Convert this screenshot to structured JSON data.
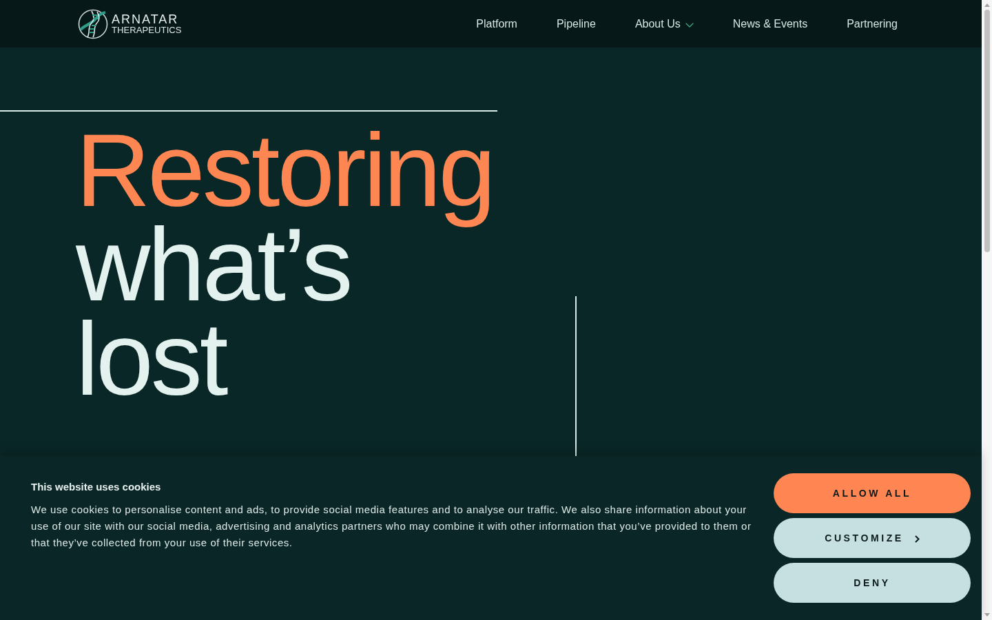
{
  "logo": {
    "name": "ARNATAR",
    "tagline": "THERAPEUTICS"
  },
  "nav": {
    "items": [
      {
        "label": "Platform",
        "dropdown": false
      },
      {
        "label": "Pipeline",
        "dropdown": false
      },
      {
        "label": "About Us",
        "dropdown": true
      },
      {
        "label": "News & Events",
        "dropdown": false
      },
      {
        "label": "Partnering",
        "dropdown": false
      }
    ]
  },
  "hero": {
    "headline": [
      {
        "text": "Restoring",
        "accent": true
      },
      {
        "text": "what’s",
        "accent": false
      },
      {
        "text": "lost",
        "accent": false
      }
    ]
  },
  "cookie_banner": {
    "title": "This website uses cookies",
    "text": "We use cookies to personalise content and ads, to provide social media features and to analyse our traffic. We also share information about your use of our site with our social media, advertising and analytics partners who may combine it with other information that you’ve provided to them or that they’ve collected from your use of their services.",
    "buttons": [
      {
        "label": "ALLOW ALL",
        "kind": "primary",
        "chevron": false
      },
      {
        "label": "CUSTOMIZE",
        "kind": "secondary",
        "chevron": true
      },
      {
        "label": "DENY",
        "kind": "secondary",
        "chevron": false
      }
    ]
  }
}
